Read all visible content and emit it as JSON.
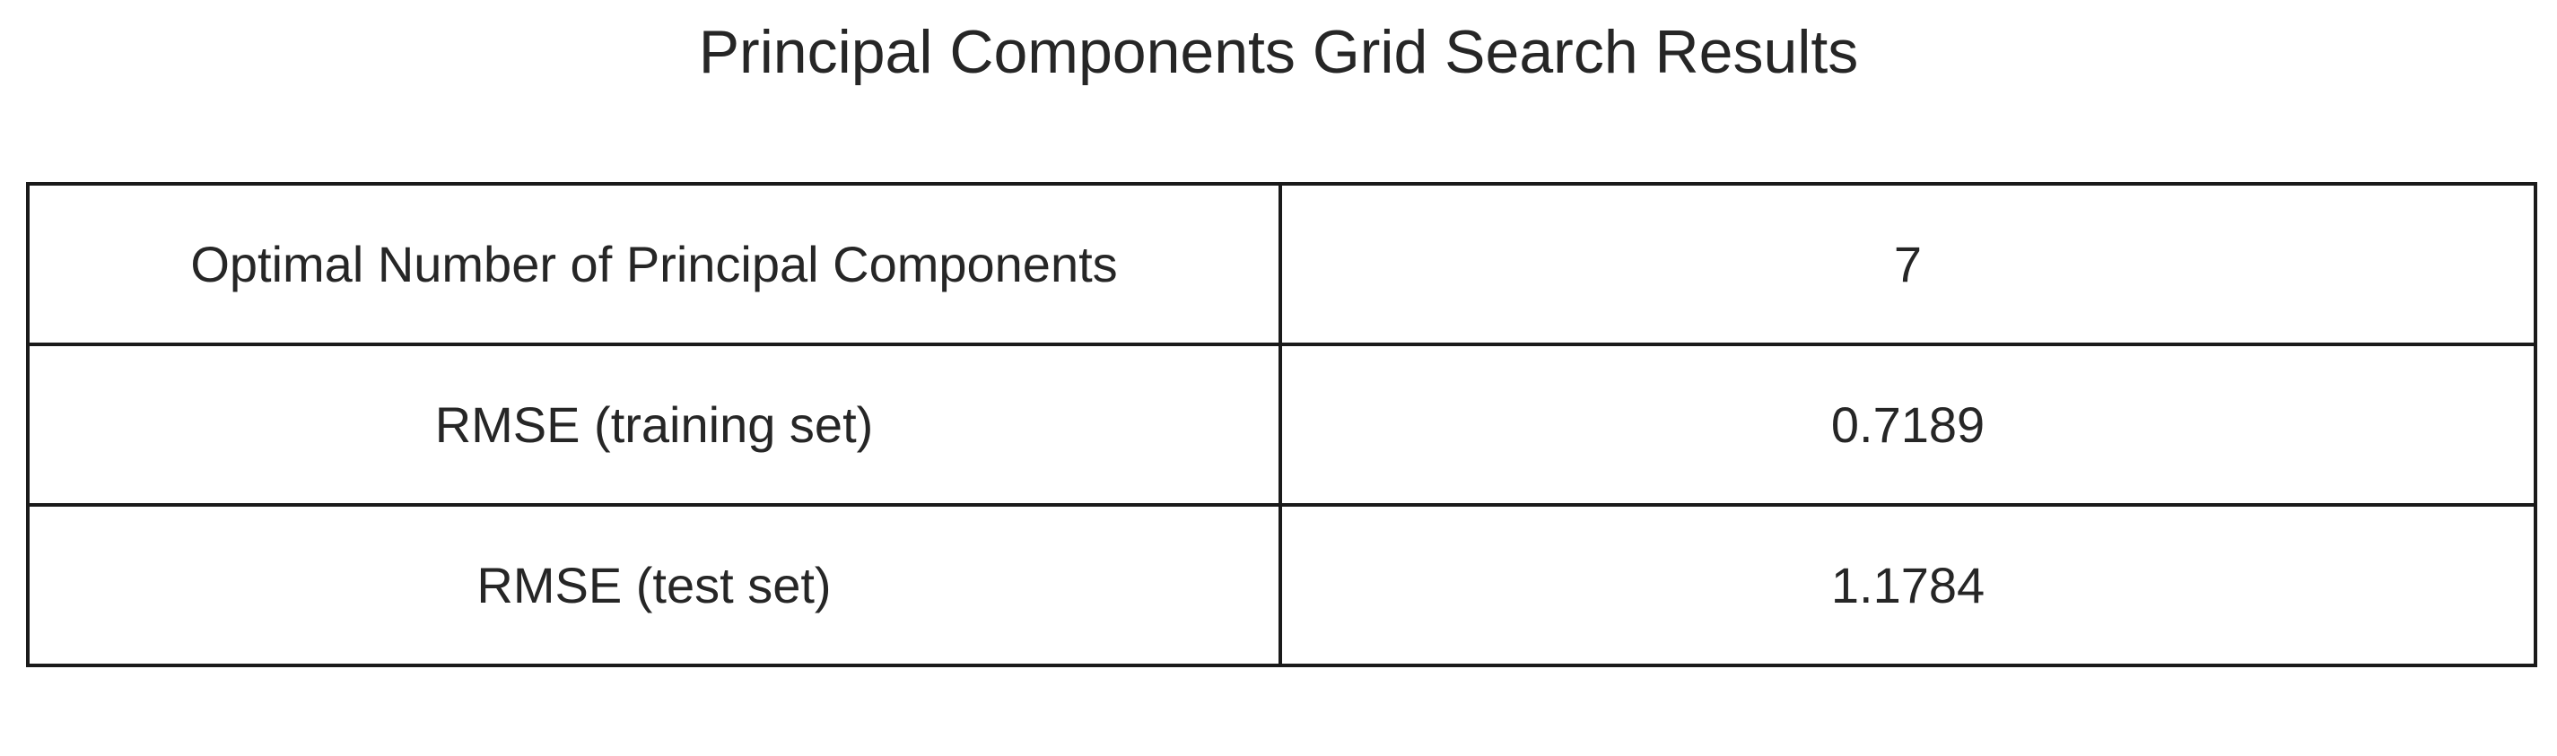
{
  "chart_data": {
    "type": "table",
    "title": "Principal Components Grid Search Results",
    "rows": [
      {
        "label": "Optimal Number of Principal Components",
        "value": "7"
      },
      {
        "label": "RMSE (training set)",
        "value": "0.7189"
      },
      {
        "label": "RMSE (test set)",
        "value": "1.1784"
      }
    ]
  },
  "colors": {
    "text": "#262626",
    "border": "#1a1a1a",
    "background": "#ffffff"
  }
}
